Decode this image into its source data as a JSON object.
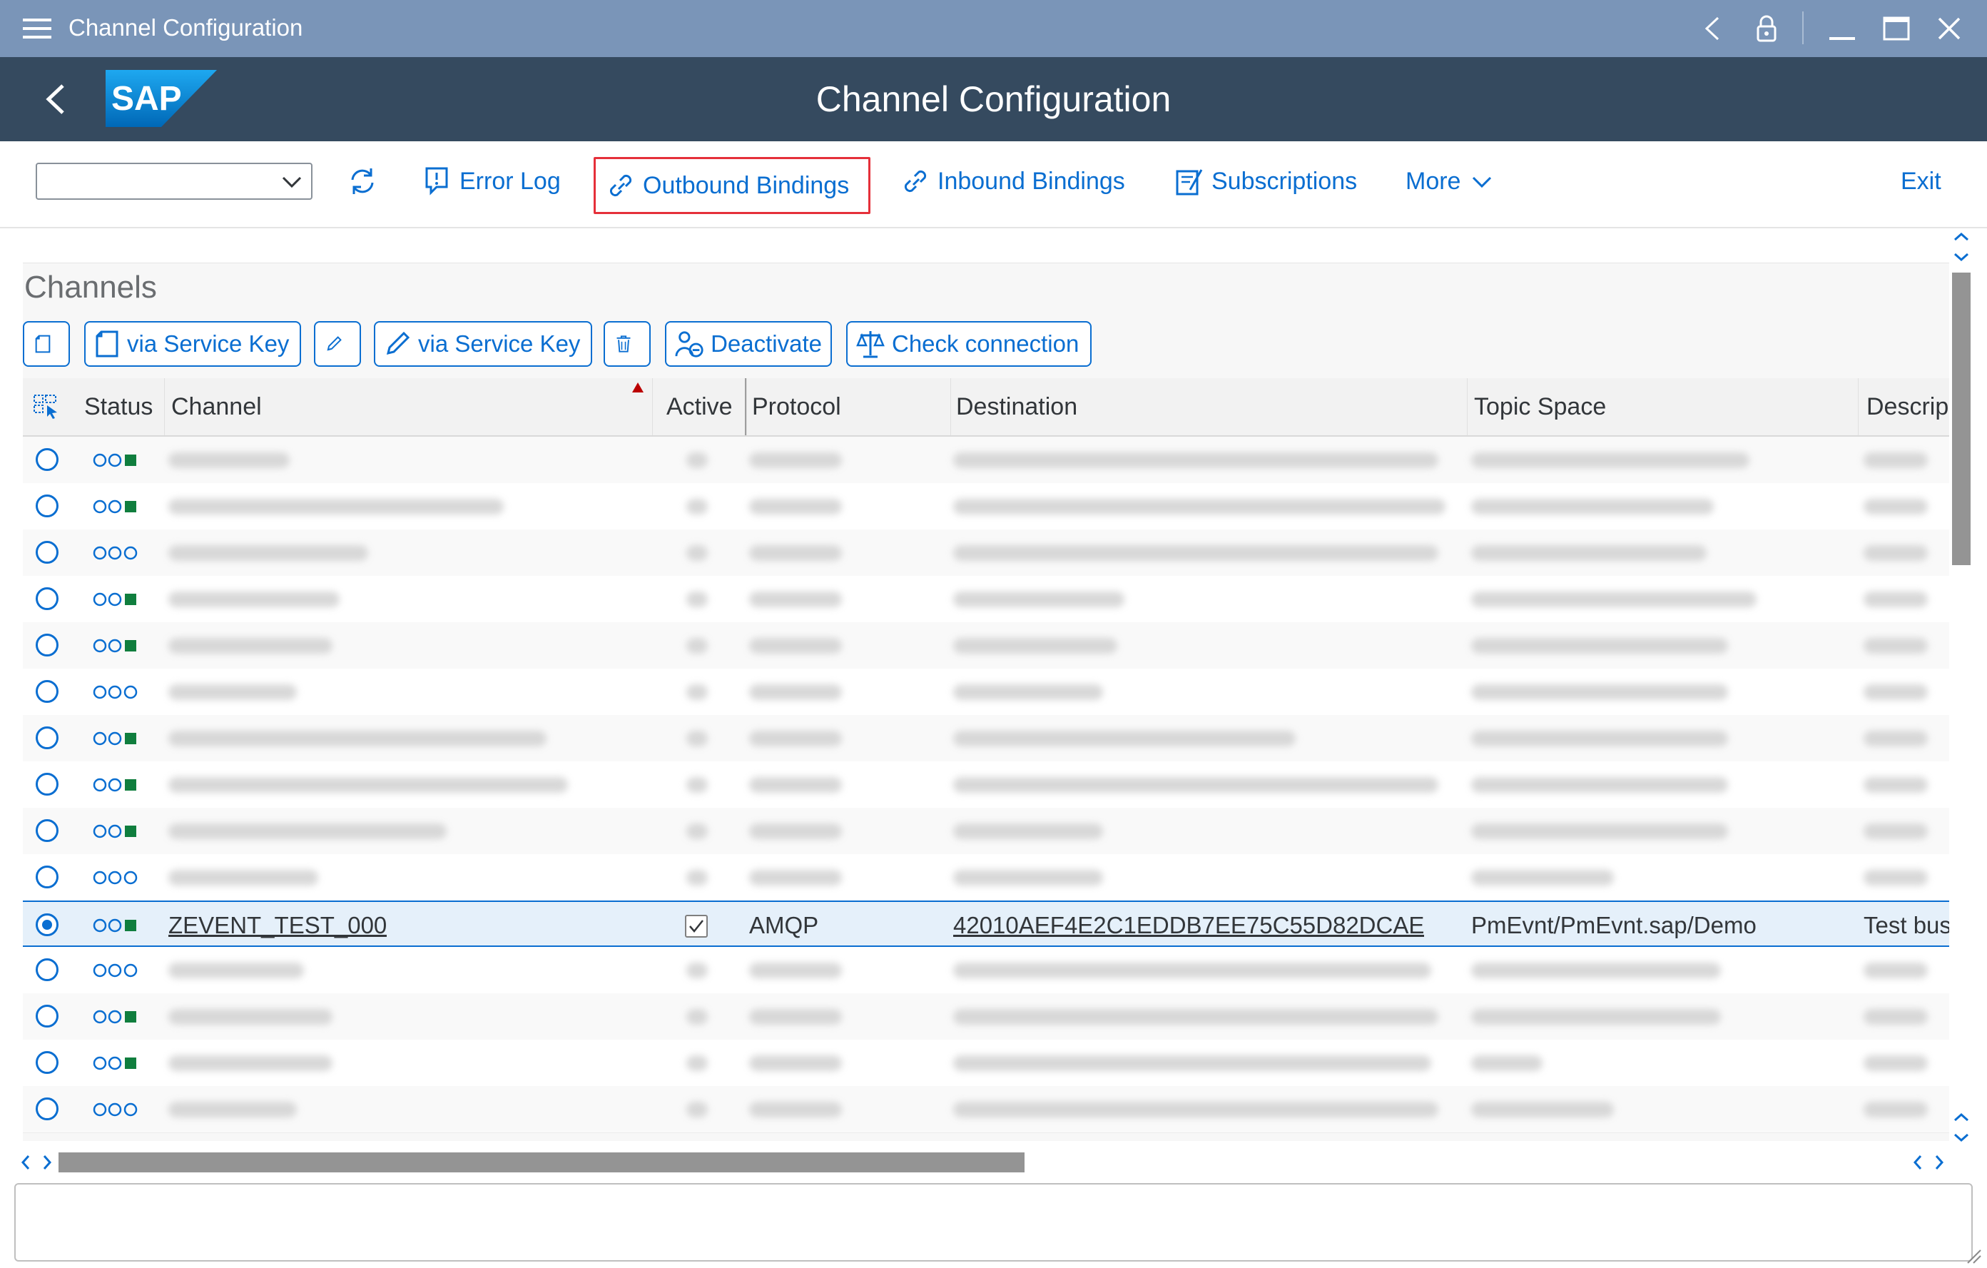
{
  "window": {
    "title": "Channel Configuration"
  },
  "shell": {
    "title": "Channel Configuration",
    "logo_text": "SAP"
  },
  "toolbar": {
    "select_value": "",
    "error_log": "Error Log",
    "outbound_bindings": "Outbound Bindings",
    "inbound_bindings": "Inbound Bindings",
    "subscriptions": "Subscriptions",
    "more": "More",
    "exit": "Exit"
  },
  "panel": {
    "title": "Channels",
    "buttons": {
      "create_via_service_key": "via Service Key",
      "edit_via_service_key": "via Service Key",
      "deactivate": "Deactivate",
      "check_connection": "Check connection"
    }
  },
  "table": {
    "columns": {
      "status": "Status",
      "channel": "Channel",
      "active": "Active",
      "protocol": "Protocol",
      "destination": "Destination",
      "topic_space": "Topic Space",
      "description": "Descrip"
    },
    "rows": [
      {
        "status": "green",
        "active": true
      },
      {
        "status": "green",
        "active": true
      },
      {
        "status": "inactive",
        "active": false
      },
      {
        "status": "green",
        "active": true
      },
      {
        "status": "green",
        "active": true
      },
      {
        "status": "inactive",
        "active": false
      },
      {
        "status": "green",
        "active": true
      },
      {
        "status": "green",
        "active": true
      },
      {
        "status": "green",
        "active": true
      },
      {
        "status": "inactive",
        "active": false
      },
      {
        "selected": true,
        "status": "green",
        "active": true,
        "channel": "ZEVENT_TEST_000",
        "protocol": "AMQP",
        "destination": "42010AEF4E2C1EDDB7EE75C55D82DCAE",
        "topic_space": "PmEvnt/PmEvnt.sap/Demo",
        "description": "Test bus"
      },
      {
        "status": "inactive",
        "active": false
      },
      {
        "status": "green",
        "active": true
      },
      {
        "status": "green",
        "active": true
      },
      {
        "status": "inactive",
        "active": false
      }
    ]
  },
  "colors": {
    "shell": "#354a5f",
    "titlebar": "#7a95b8",
    "accent": "#0a6ed1",
    "status_green": "#107e3e",
    "highlight_border": "#e5303a"
  },
  "icons": [
    "menu-icon",
    "chevron-left-icon",
    "lock-icon",
    "minimize-icon",
    "maximize-icon",
    "close-icon",
    "refresh-icon",
    "error-log-icon",
    "link-icon",
    "subscriptions-icon",
    "chevron-down-icon",
    "create-icon",
    "pencil-icon",
    "trash-icon",
    "deactivate-icon",
    "scale-icon"
  ]
}
